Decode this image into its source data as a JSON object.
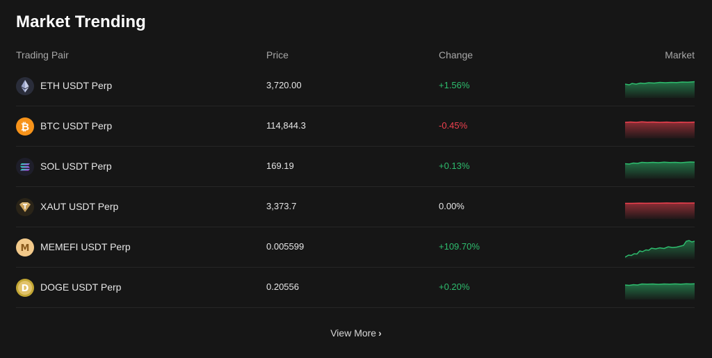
{
  "title": "Market Trending",
  "headers": {
    "pair": "Trading Pair",
    "price": "Price",
    "change": "Change",
    "market": "Market"
  },
  "rows": [
    {
      "pair": "ETH USDT Perp",
      "price": "3,720.00",
      "change": "+1.56%",
      "trend": "up",
      "icon": "eth-icon"
    },
    {
      "pair": "BTC USDT Perp",
      "price": "114,844.3",
      "change": "-0.45%",
      "trend": "down",
      "icon": "btc-icon"
    },
    {
      "pair": "SOL USDT Perp",
      "price": "169.19",
      "change": "+0.13%",
      "trend": "up",
      "icon": "sol-icon"
    },
    {
      "pair": "XAUT USDT Perp",
      "price": "3,373.7",
      "change": "0.00%",
      "trend": "flat",
      "icon": "xaut-icon"
    },
    {
      "pair": "MEMEFI USDT Perp",
      "price": "0.005599",
      "change": "+109.70%",
      "trend": "up",
      "icon": "memefi-icon"
    },
    {
      "pair": "DOGE USDT Perp",
      "price": "0.20556",
      "change": "+0.20%",
      "trend": "up",
      "icon": "doge-icon"
    }
  ],
  "view_more": "View More",
  "colors": {
    "up": "#2ebd6e",
    "down": "#f0414f",
    "background": "#161616"
  }
}
